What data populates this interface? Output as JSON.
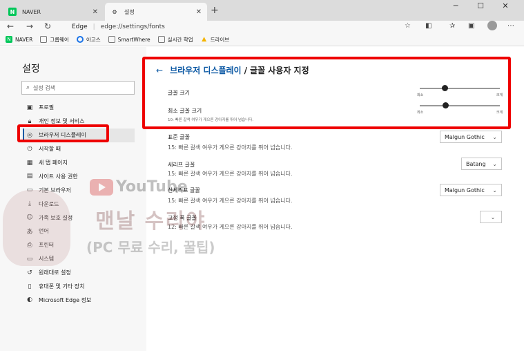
{
  "tabs": [
    {
      "title": "NAVER",
      "icon": "naver-favicon"
    },
    {
      "title": "설정",
      "icon": "gear-icon"
    }
  ],
  "address": {
    "edge_label": "Edge",
    "url": "edge://settings/fonts"
  },
  "bookmarks": [
    {
      "label": "NAVER",
      "icon": "naver-favicon"
    },
    {
      "label": "그룹웨어",
      "icon": "page-icon"
    },
    {
      "label": "아고스",
      "icon": "circle-icon"
    },
    {
      "label": "SmartWhere",
      "icon": "page-icon"
    },
    {
      "label": "실시간 학업",
      "icon": "page-icon"
    },
    {
      "label": "드라이브",
      "icon": "drive-icon"
    }
  ],
  "sidebar": {
    "title": "설정",
    "search_placeholder": "설정 검색",
    "items": [
      {
        "label": "프로필",
        "icon": "profile-icon"
      },
      {
        "label": "개인 정보 및 서비스",
        "icon": "lock-icon"
      },
      {
        "label": "브라우저 디스플레이",
        "icon": "palette-icon"
      },
      {
        "label": "시작할 때",
        "icon": "power-icon"
      },
      {
        "label": "새 탭 페이지",
        "icon": "newtab-icon"
      },
      {
        "label": "사이트 사용 권한",
        "icon": "site-permissions-icon"
      },
      {
        "label": "기본 브라우저",
        "icon": "browser-icon"
      },
      {
        "label": "다운로드",
        "icon": "download-icon"
      },
      {
        "label": "가족 보호 설정",
        "icon": "family-icon"
      },
      {
        "label": "언어",
        "icon": "language-icon"
      },
      {
        "label": "프린터",
        "icon": "printer-icon"
      },
      {
        "label": "시스템",
        "icon": "system-icon"
      },
      {
        "label": "원래대로 설정",
        "icon": "reset-icon"
      },
      {
        "label": "휴대폰 및 기타 장치",
        "icon": "phone-icon"
      },
      {
        "label": "Microsoft Edge 정보",
        "icon": "edge-icon"
      }
    ]
  },
  "main": {
    "crumb_parent": "브라우저 디스플레이",
    "crumb_sep": "/",
    "crumb_current": "글꼴 사용자 지정",
    "font_size": {
      "label": "글꼴 크기",
      "min_label": "최소",
      "max_label": "크게",
      "value": 0.31
    },
    "min_font_size": {
      "label": "최소 글꼴 크기",
      "desc": "10: 빠른 갈색 여우가 게으른 강아지를 뛰어 넘습니다.",
      "min_label": "최소",
      "max_label": "크게",
      "value": 0.32
    },
    "standard_font": {
      "label": "표준 글꼴",
      "desc": "15: 빠른 갈색 여우가 게으른 강아지를 뛰어 넘습니다.",
      "value": "Malgun Gothic"
    },
    "serif_font": {
      "label": "세리프 글꼴",
      "desc": "15: 빠른 갈색 여우가 게으른 강아지를 뛰어 넘습니다.",
      "value": "Batang"
    },
    "sans_serif_font": {
      "label": "산세리프 글꼴",
      "desc": "15: 빠른 갈색 여우가 게으른 강아지를 뛰어 넘습니다.",
      "value": "Malgun Gothic"
    },
    "fixed_font": {
      "label": "고정 폭 글꼴",
      "desc": "12: 빠른 갈색 여우가 게으른 강아지를 뛰어 넘습니다.",
      "value": ""
    }
  },
  "watermark": {
    "brand": "YouTube",
    "title": "맨날 수리야",
    "subtitle": "(PC 무료 수리, 꿀팁)"
  },
  "colors": {
    "accent": "#0c59a4",
    "highlight_box": "#e00000"
  }
}
